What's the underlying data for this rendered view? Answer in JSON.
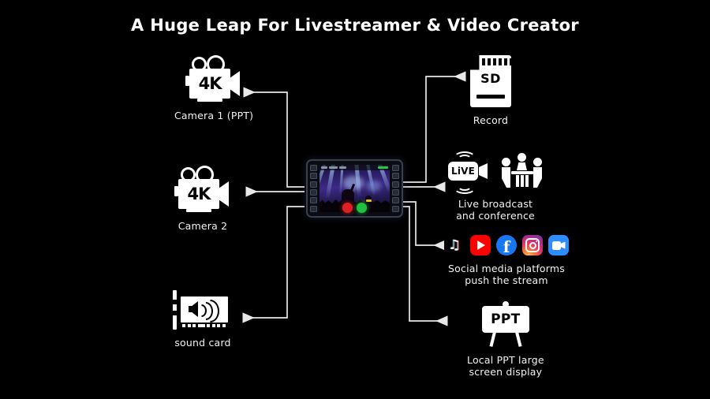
{
  "page": {
    "title": "A Huge Leap For Livestreamer &  Video Creator",
    "background_color": "#000000",
    "text_color": "#ffffff"
  },
  "inputs": [
    {
      "id": "camera-1",
      "icon": "video-camera-4k-icon",
      "icon_text": "4K",
      "label": "Camera 1 (PPT)"
    },
    {
      "id": "camera-2",
      "icon": "video-camera-4k-icon",
      "icon_text": "4K",
      "label": "Camera 2"
    },
    {
      "id": "sound-card",
      "icon": "sound-card-icon",
      "icon_text": "",
      "label": "sound card"
    }
  ],
  "device": {
    "name": "video-switcher-monitor",
    "screen_content": "live concert stage with blue spotlights and crowd",
    "buttons": [
      {
        "name": "record-button",
        "color": "#e02020"
      },
      {
        "name": "play-button",
        "color": "#20c040"
      }
    ]
  },
  "outputs": [
    {
      "id": "record",
      "icons": [
        "sd-card-icon"
      ],
      "icon_text": "SD",
      "label": "Record"
    },
    {
      "id": "live-broadcast",
      "icons": [
        "live-camera-icon",
        "conference-people-icon"
      ],
      "icon_text": "LiVE",
      "label": "Live broadcast\nand conference"
    },
    {
      "id": "social-media",
      "icons": [
        "tiktok-icon",
        "youtube-icon",
        "facebook-icon",
        "instagram-icon",
        "zoom-icon"
      ],
      "label": "Social media platforms\npush the stream"
    },
    {
      "id": "local-ppt",
      "icons": [
        "presentation-board-icon"
      ],
      "icon_text": "PPT",
      "label": "Local PPT large\nscreen display"
    }
  ],
  "social_platforms": [
    {
      "name": "TikTok",
      "color": "#000000"
    },
    {
      "name": "YouTube",
      "color": "#FF0000"
    },
    {
      "name": "Facebook",
      "color": "#1877F2"
    },
    {
      "name": "Instagram",
      "color": "#E1306C"
    },
    {
      "name": "Zoom",
      "color": "#2D8CFF"
    }
  ],
  "arrows": {
    "color": "#e8e8e8",
    "count": 7
  }
}
